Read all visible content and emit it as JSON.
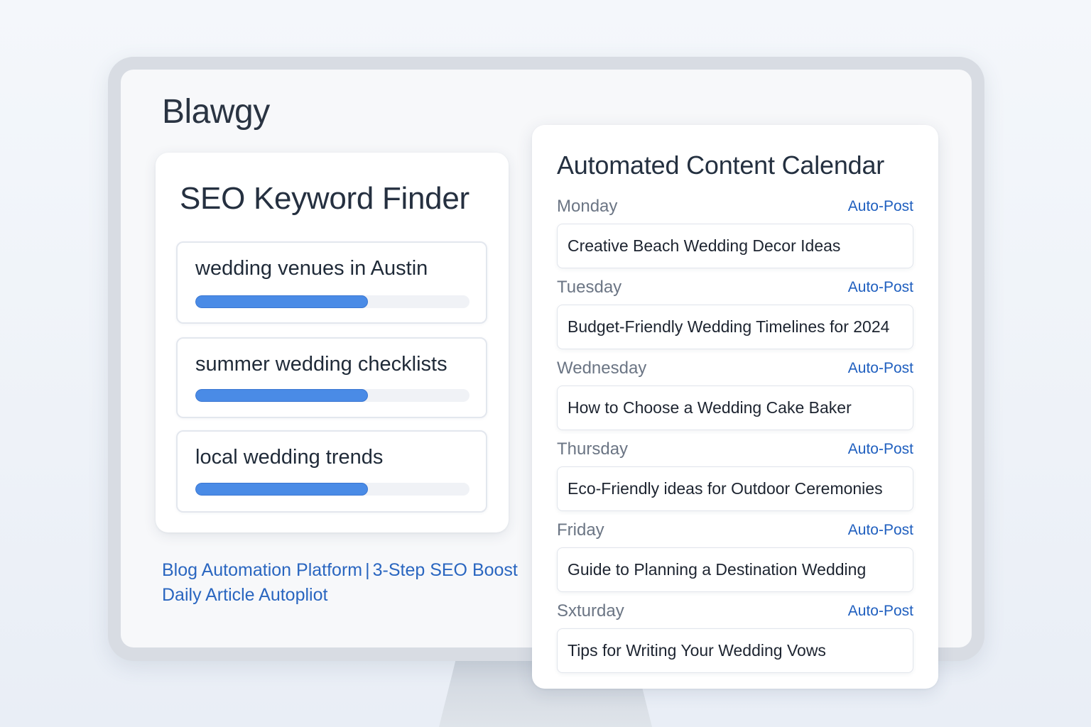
{
  "app": {
    "brand": "Blawgy"
  },
  "seo": {
    "title": "SEO Keyword Finder",
    "keywords": [
      {
        "label": "wedding venues in Austin",
        "score": 0.63
      },
      {
        "label": "summer wedding checklists",
        "score": 0.63
      },
      {
        "label": "local wedding trends",
        "score": 0.63
      }
    ]
  },
  "footer": {
    "link1": "Blog Automation Platform",
    "separator": "|",
    "link2": "3-Step SEO Boost",
    "link3": "Daily Article Autopliot"
  },
  "calendar": {
    "title": "Automated Content Calendar",
    "days": [
      {
        "day": "Monday",
        "status": "Auto-Post",
        "post": "Creative Beach Wedding Decor Ideas"
      },
      {
        "day": "Tuesday",
        "status": "Auto-Post",
        "post": "Budget-Friendly Wedding Timelines for 2024"
      },
      {
        "day": "Wednesday",
        "status": "Auto-Post",
        "post": "How to Choose a Wedding Cake Baker"
      },
      {
        "day": "Thursday",
        "status": "Auto-Post",
        "post": "Eco-Friendly ideas for Outdoor Ceremonies"
      },
      {
        "day": "Friday",
        "status": "Auto-Post",
        "post": "Guide to Planning a Destination Wedding"
      },
      {
        "day": "Sxturday",
        "status": "Auto-Post",
        "post": "Tips for Writing Your Wedding Vows"
      }
    ]
  },
  "colors": {
    "accent": "#4a8be6",
    "link": "#2a66c0",
    "text": "#1f2a38"
  }
}
